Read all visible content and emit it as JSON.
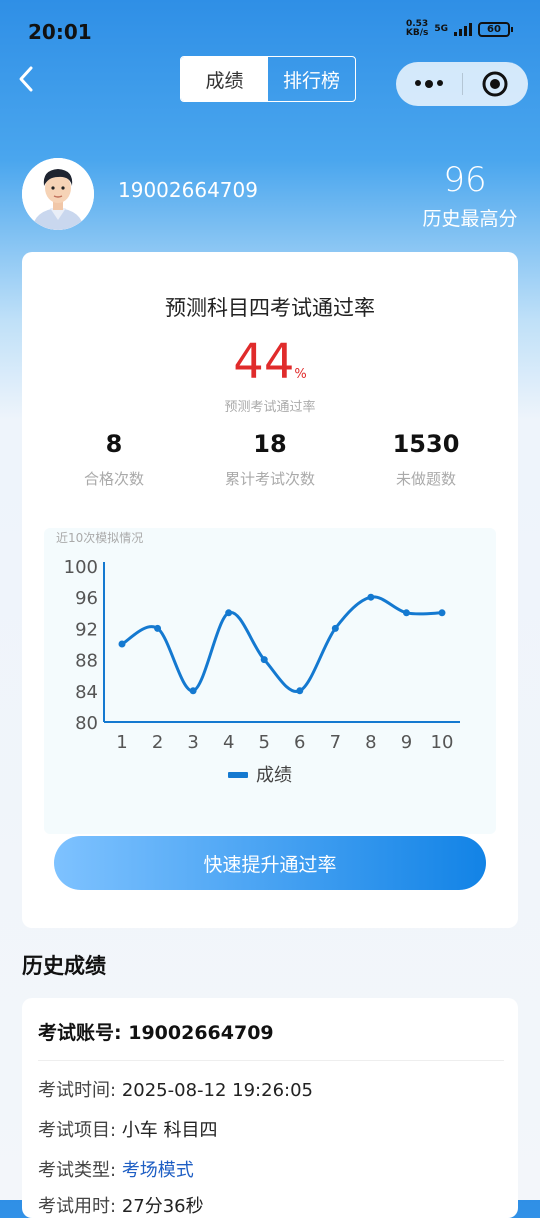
{
  "status_bar": {
    "time": "20:01",
    "net_speed": "0.53",
    "net_unit": "KB/s",
    "signal": "5G",
    "battery": "60"
  },
  "nav": {
    "tabs": [
      {
        "label": "成绩",
        "active": true
      },
      {
        "label": "排行榜",
        "active": false
      }
    ]
  },
  "profile": {
    "phone": "19002664709",
    "best_score": "96",
    "best_score_label": "历史最高分"
  },
  "prediction": {
    "title": "预测科目四考试通过率",
    "rate": "44",
    "rate_unit": "%",
    "rate_label": "预测考试通过率",
    "stats": [
      {
        "value": "8",
        "label": "合格次数"
      },
      {
        "value": "18",
        "label": "累计考试次数"
      },
      {
        "value": "1530",
        "label": "未做题数"
      }
    ],
    "boost_button": "快速提升通过率"
  },
  "chart_data": {
    "type": "line",
    "title": "近10次模拟情况",
    "x": [
      1,
      2,
      3,
      4,
      5,
      6,
      7,
      8,
      9,
      10
    ],
    "series": [
      {
        "name": "成绩",
        "values": [
          90,
          92,
          84,
          94,
          88,
          84,
          92,
          96,
          94,
          94
        ]
      }
    ],
    "yticks": [
      80,
      84,
      88,
      92,
      96,
      100
    ],
    "ylim": [
      80,
      100
    ],
    "legend": "bottom",
    "grid": false,
    "color": "#1479d0"
  },
  "history": {
    "title": "历史成绩",
    "account_label": "考试账号:",
    "account_value": "19002664709",
    "rows": [
      {
        "label": "考试时间:",
        "value": "2025-08-12 19:26:05"
      },
      {
        "label": "考试项目:",
        "value": "小车 科目四"
      },
      {
        "label": "考试类型:",
        "value": "考场模式"
      },
      {
        "label": "考试用时:",
        "value": "27分36秒"
      }
    ]
  }
}
